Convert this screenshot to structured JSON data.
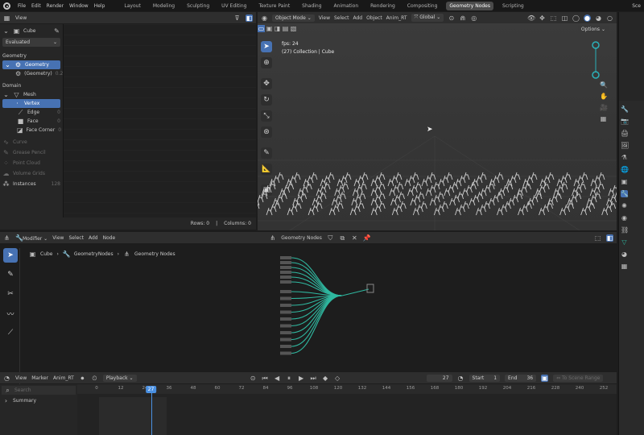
{
  "topbar": {
    "menus": [
      "File",
      "Edit",
      "Render",
      "Window",
      "Help"
    ],
    "workspaces": [
      "Layout",
      "Modeling",
      "Sculpting",
      "UV Editing",
      "Texture Paint",
      "Shading",
      "Animation",
      "Rendering",
      "Compositing",
      "Geometry Nodes",
      "Scripting"
    ],
    "active_workspace": "Geometry Nodes",
    "right_text": "Sce"
  },
  "spreadsheet": {
    "view_label": "View",
    "object": "Cube",
    "evaluated": "Evaluated",
    "geometry_section": "Geometry",
    "geometry_item": "Geometry",
    "geometry_sub": "(Geometry)",
    "geometry_sub_count": "0.2k",
    "domain_section": "Domain",
    "mesh_label": "Mesh",
    "domains": [
      {
        "label": "Vertex",
        "count": "",
        "active": true
      },
      {
        "label": "Edge",
        "count": "0"
      },
      {
        "label": "Face",
        "count": "0"
      },
      {
        "label": "Face Corner",
        "count": "0"
      }
    ],
    "disabled_domains": [
      "Curve",
      "Grease Pencil",
      "Point Cloud",
      "Volume Grids"
    ],
    "instances_label": "Instances",
    "instances_count": "128",
    "rows_label": "Rows: 0",
    "columns_label": "Columns: 0"
  },
  "viewport": {
    "mode": "Object Mode",
    "menus": [
      "View",
      "Select",
      "Add",
      "Object",
      "Anim_RT"
    ],
    "orientation": "Global",
    "options": "Options",
    "fps": "fps: 24",
    "collection": "(27) Collection | Cube"
  },
  "node_editor": {
    "editor_type": "Modifier",
    "menus": [
      "View",
      "Select",
      "Add",
      "Node"
    ],
    "tree_name": "Geometry Nodes",
    "breadcrumb": [
      "Cube",
      "GeometryNodes",
      "Geometry Nodes"
    ]
  },
  "timeline": {
    "menus": [
      "View",
      "Marker",
      "Anim_RT"
    ],
    "playback": "Playback",
    "current_frame": "27",
    "start_label": "Start",
    "start": "1",
    "end_label": "End",
    "end": "36",
    "scene_range": "To Scene Range",
    "search_placeholder": "Search",
    "summary": "Summary",
    "ticks": [
      "0",
      "12",
      "24",
      "36",
      "48",
      "60",
      "72",
      "84",
      "96",
      "108",
      "120",
      "132",
      "144",
      "156",
      "168",
      "180",
      "192",
      "204",
      "216",
      "228",
      "240",
      "252"
    ],
    "playhead": "27"
  },
  "colors": {
    "accent": "#4772b3",
    "node_wire": "#2fb8a0",
    "gizmo": "#2bb0b8"
  }
}
